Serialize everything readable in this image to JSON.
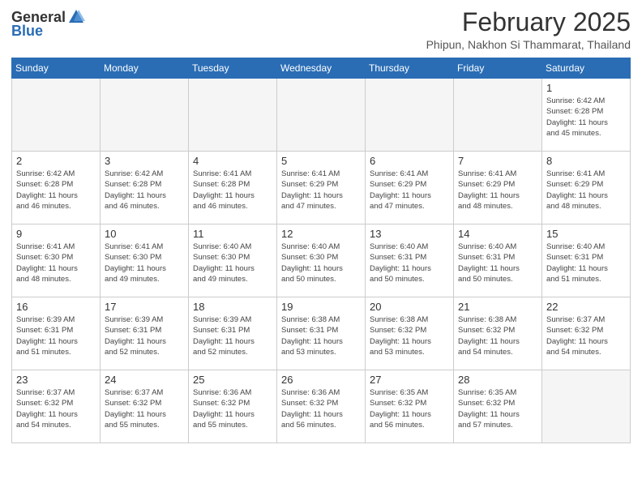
{
  "header": {
    "logo_general": "General",
    "logo_blue": "Blue",
    "month": "February 2025",
    "location": "Phipun, Nakhon Si Thammarat, Thailand"
  },
  "weekdays": [
    "Sunday",
    "Monday",
    "Tuesday",
    "Wednesday",
    "Thursday",
    "Friday",
    "Saturday"
  ],
  "weeks": [
    [
      {
        "day": "",
        "info": ""
      },
      {
        "day": "",
        "info": ""
      },
      {
        "day": "",
        "info": ""
      },
      {
        "day": "",
        "info": ""
      },
      {
        "day": "",
        "info": ""
      },
      {
        "day": "",
        "info": ""
      },
      {
        "day": "1",
        "info": "Sunrise: 6:42 AM\nSunset: 6:28 PM\nDaylight: 11 hours\nand 45 minutes."
      }
    ],
    [
      {
        "day": "2",
        "info": "Sunrise: 6:42 AM\nSunset: 6:28 PM\nDaylight: 11 hours\nand 46 minutes."
      },
      {
        "day": "3",
        "info": "Sunrise: 6:42 AM\nSunset: 6:28 PM\nDaylight: 11 hours\nand 46 minutes."
      },
      {
        "day": "4",
        "info": "Sunrise: 6:41 AM\nSunset: 6:28 PM\nDaylight: 11 hours\nand 46 minutes."
      },
      {
        "day": "5",
        "info": "Sunrise: 6:41 AM\nSunset: 6:29 PM\nDaylight: 11 hours\nand 47 minutes."
      },
      {
        "day": "6",
        "info": "Sunrise: 6:41 AM\nSunset: 6:29 PM\nDaylight: 11 hours\nand 47 minutes."
      },
      {
        "day": "7",
        "info": "Sunrise: 6:41 AM\nSunset: 6:29 PM\nDaylight: 11 hours\nand 48 minutes."
      },
      {
        "day": "8",
        "info": "Sunrise: 6:41 AM\nSunset: 6:29 PM\nDaylight: 11 hours\nand 48 minutes."
      }
    ],
    [
      {
        "day": "9",
        "info": "Sunrise: 6:41 AM\nSunset: 6:30 PM\nDaylight: 11 hours\nand 48 minutes."
      },
      {
        "day": "10",
        "info": "Sunrise: 6:41 AM\nSunset: 6:30 PM\nDaylight: 11 hours\nand 49 minutes."
      },
      {
        "day": "11",
        "info": "Sunrise: 6:40 AM\nSunset: 6:30 PM\nDaylight: 11 hours\nand 49 minutes."
      },
      {
        "day": "12",
        "info": "Sunrise: 6:40 AM\nSunset: 6:30 PM\nDaylight: 11 hours\nand 50 minutes."
      },
      {
        "day": "13",
        "info": "Sunrise: 6:40 AM\nSunset: 6:31 PM\nDaylight: 11 hours\nand 50 minutes."
      },
      {
        "day": "14",
        "info": "Sunrise: 6:40 AM\nSunset: 6:31 PM\nDaylight: 11 hours\nand 50 minutes."
      },
      {
        "day": "15",
        "info": "Sunrise: 6:40 AM\nSunset: 6:31 PM\nDaylight: 11 hours\nand 51 minutes."
      }
    ],
    [
      {
        "day": "16",
        "info": "Sunrise: 6:39 AM\nSunset: 6:31 PM\nDaylight: 11 hours\nand 51 minutes."
      },
      {
        "day": "17",
        "info": "Sunrise: 6:39 AM\nSunset: 6:31 PM\nDaylight: 11 hours\nand 52 minutes."
      },
      {
        "day": "18",
        "info": "Sunrise: 6:39 AM\nSunset: 6:31 PM\nDaylight: 11 hours\nand 52 minutes."
      },
      {
        "day": "19",
        "info": "Sunrise: 6:38 AM\nSunset: 6:31 PM\nDaylight: 11 hours\nand 53 minutes."
      },
      {
        "day": "20",
        "info": "Sunrise: 6:38 AM\nSunset: 6:32 PM\nDaylight: 11 hours\nand 53 minutes."
      },
      {
        "day": "21",
        "info": "Sunrise: 6:38 AM\nSunset: 6:32 PM\nDaylight: 11 hours\nand 54 minutes."
      },
      {
        "day": "22",
        "info": "Sunrise: 6:37 AM\nSunset: 6:32 PM\nDaylight: 11 hours\nand 54 minutes."
      }
    ],
    [
      {
        "day": "23",
        "info": "Sunrise: 6:37 AM\nSunset: 6:32 PM\nDaylight: 11 hours\nand 54 minutes."
      },
      {
        "day": "24",
        "info": "Sunrise: 6:37 AM\nSunset: 6:32 PM\nDaylight: 11 hours\nand 55 minutes."
      },
      {
        "day": "25",
        "info": "Sunrise: 6:36 AM\nSunset: 6:32 PM\nDaylight: 11 hours\nand 55 minutes."
      },
      {
        "day": "26",
        "info": "Sunrise: 6:36 AM\nSunset: 6:32 PM\nDaylight: 11 hours\nand 56 minutes."
      },
      {
        "day": "27",
        "info": "Sunrise: 6:35 AM\nSunset: 6:32 PM\nDaylight: 11 hours\nand 56 minutes."
      },
      {
        "day": "28",
        "info": "Sunrise: 6:35 AM\nSunset: 6:32 PM\nDaylight: 11 hours\nand 57 minutes."
      },
      {
        "day": "",
        "info": ""
      }
    ]
  ]
}
